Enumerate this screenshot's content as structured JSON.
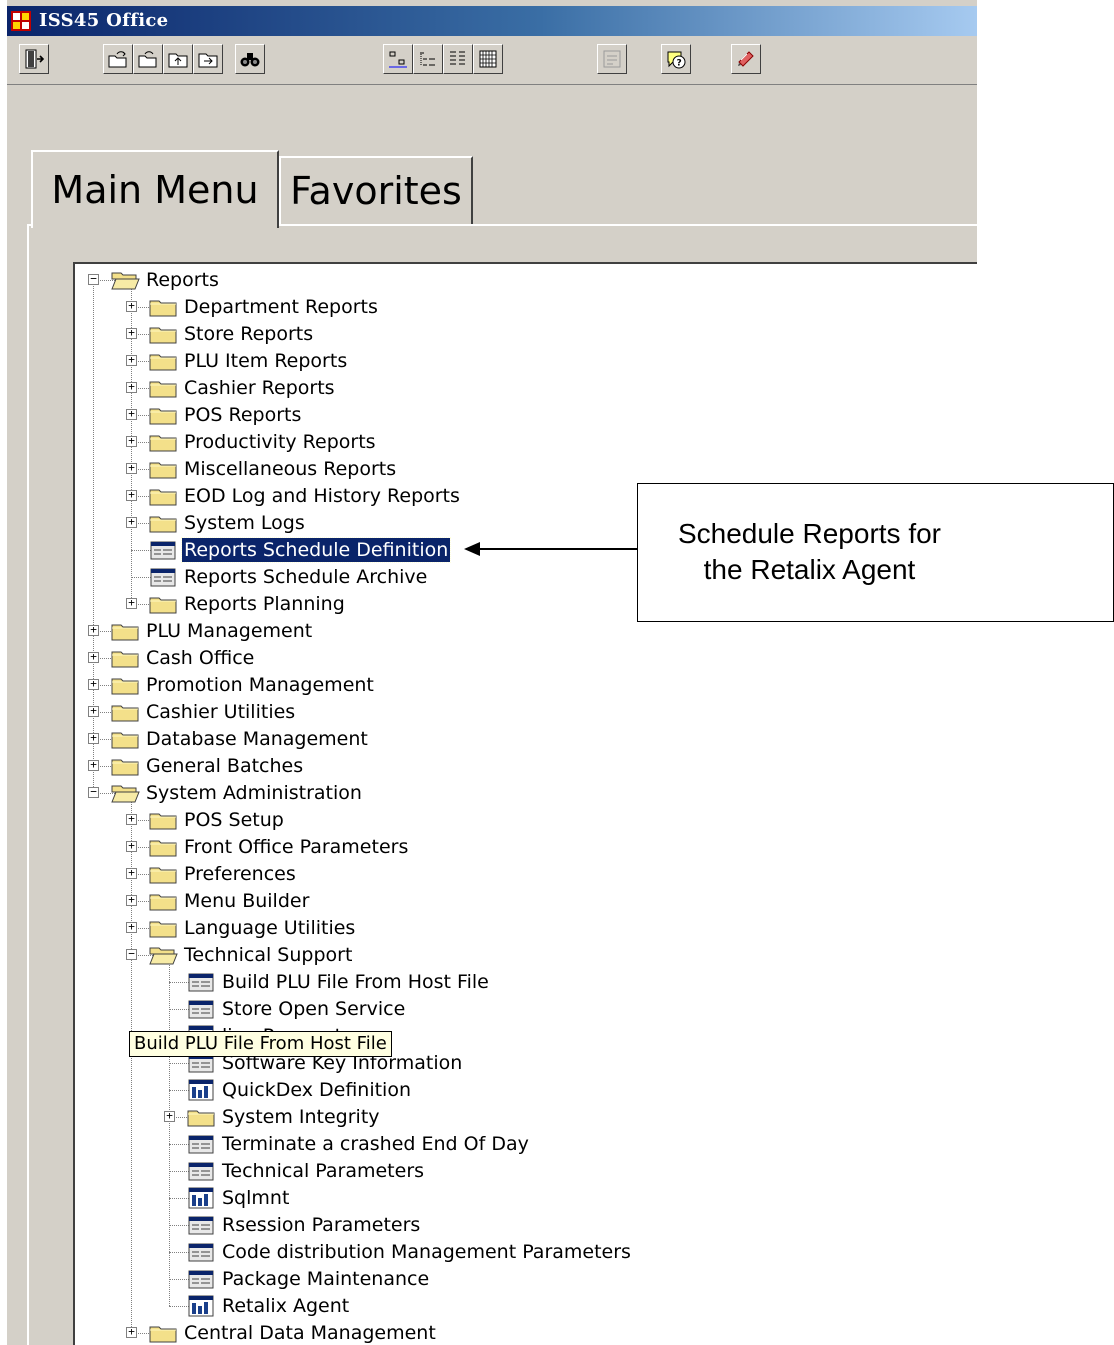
{
  "window": {
    "title": "ISS45 Office"
  },
  "toolbar": {
    "buttons": [
      "exit-icon",
      "open-icon",
      "open-redo-icon",
      "folder-up-icon",
      "folder-in-icon",
      "find-icon",
      "small-icons-icon",
      "list-view-icon",
      "detail-view-icon",
      "grid-view-icon",
      "disabled-tool-icon",
      "help-icon",
      "notes-icon"
    ]
  },
  "tabs": {
    "main": "Main Menu",
    "favorites": "Favorites"
  },
  "tree": [
    {
      "label": "Reports",
      "level": 0,
      "type": "folder-open",
      "exp": "minus"
    },
    {
      "label": "Department Reports",
      "level": 1,
      "type": "folder",
      "exp": "plus"
    },
    {
      "label": "Store Reports",
      "level": 1,
      "type": "folder",
      "exp": "plus"
    },
    {
      "label": "PLU Item Reports",
      "level": 1,
      "type": "folder",
      "exp": "plus"
    },
    {
      "label": "Cashier Reports",
      "level": 1,
      "type": "folder",
      "exp": "plus"
    },
    {
      "label": "POS Reports",
      "level": 1,
      "type": "folder",
      "exp": "plus"
    },
    {
      "label": "Productivity Reports",
      "level": 1,
      "type": "folder",
      "exp": "plus"
    },
    {
      "label": "Miscellaneous Reports",
      "level": 1,
      "type": "folder",
      "exp": "plus"
    },
    {
      "label": "EOD Log and History Reports",
      "level": 1,
      "type": "folder",
      "exp": "plus"
    },
    {
      "label": "System Logs",
      "level": 1,
      "type": "folder",
      "exp": "plus"
    },
    {
      "label": "Reports Schedule Definition",
      "level": 1,
      "type": "form",
      "exp": "",
      "selected": true
    },
    {
      "label": "Reports Schedule Archive",
      "level": 1,
      "type": "form",
      "exp": ""
    },
    {
      "label": "Reports Planning",
      "level": 1,
      "type": "folder",
      "exp": "plus"
    },
    {
      "label": "PLU Management",
      "level": 0,
      "type": "folder",
      "exp": "plus"
    },
    {
      "label": "Cash Office",
      "level": 0,
      "type": "folder",
      "exp": "plus"
    },
    {
      "label": "Promotion Management",
      "level": 0,
      "type": "folder",
      "exp": "plus"
    },
    {
      "label": "Cashier Utilities",
      "level": 0,
      "type": "folder",
      "exp": "plus"
    },
    {
      "label": "Database Management",
      "level": 0,
      "type": "folder",
      "exp": "plus"
    },
    {
      "label": "General Batches",
      "level": 0,
      "type": "folder",
      "exp": "plus"
    },
    {
      "label": "System Administration",
      "level": 0,
      "type": "folder-open",
      "exp": "minus"
    },
    {
      "label": "POS Setup",
      "level": 1,
      "type": "folder",
      "exp": "plus"
    },
    {
      "label": "Front Office Parameters",
      "level": 1,
      "type": "folder",
      "exp": "plus"
    },
    {
      "label": "Preferences",
      "level": 1,
      "type": "folder",
      "exp": "plus"
    },
    {
      "label": "Menu Builder",
      "level": 1,
      "type": "folder",
      "exp": "plus"
    },
    {
      "label": "Language Utilities",
      "level": 1,
      "type": "folder",
      "exp": "plus"
    },
    {
      "label": "Technical Support",
      "level": 1,
      "type": "folder-open",
      "exp": "minus"
    },
    {
      "label": "Build PLU File From Host File",
      "level": 2,
      "type": "form",
      "exp": ""
    },
    {
      "label": "Store Open Service",
      "level": 2,
      "type": "form",
      "exp": ""
    },
    {
      "label": "ling Parameters",
      "level": 2,
      "type": "app",
      "exp": ""
    },
    {
      "label": "Software Key Information",
      "level": 2,
      "type": "form",
      "exp": ""
    },
    {
      "label": "QuickDex Definition",
      "level": 2,
      "type": "app",
      "exp": ""
    },
    {
      "label": "System Integrity",
      "level": 2,
      "type": "folder",
      "exp": "plus"
    },
    {
      "label": "Terminate a crashed End Of Day",
      "level": 2,
      "type": "form",
      "exp": ""
    },
    {
      "label": "Technical Parameters",
      "level": 2,
      "type": "form",
      "exp": ""
    },
    {
      "label": "Sqlmnt",
      "level": 2,
      "type": "app",
      "exp": ""
    },
    {
      "label": "Rsession Parameters",
      "level": 2,
      "type": "form",
      "exp": ""
    },
    {
      "label": "Code distribution Management Parameters",
      "level": 2,
      "type": "form",
      "exp": ""
    },
    {
      "label": "Package Maintenance",
      "level": 2,
      "type": "form",
      "exp": ""
    },
    {
      "label": "Retalix Agent",
      "level": 2,
      "type": "app",
      "exp": ""
    },
    {
      "label": "Central Data Management",
      "level": 1,
      "type": "folder",
      "exp": "plus"
    }
  ],
  "tooltip": "Build PLU File From Host File",
  "callout": {
    "line1": "Schedule Reports for",
    "line2": "the Retalix Agent"
  },
  "colors": {
    "selection": "#0a246a",
    "titlebar": "#0a246a",
    "chrome": "#d4d0c8"
  }
}
